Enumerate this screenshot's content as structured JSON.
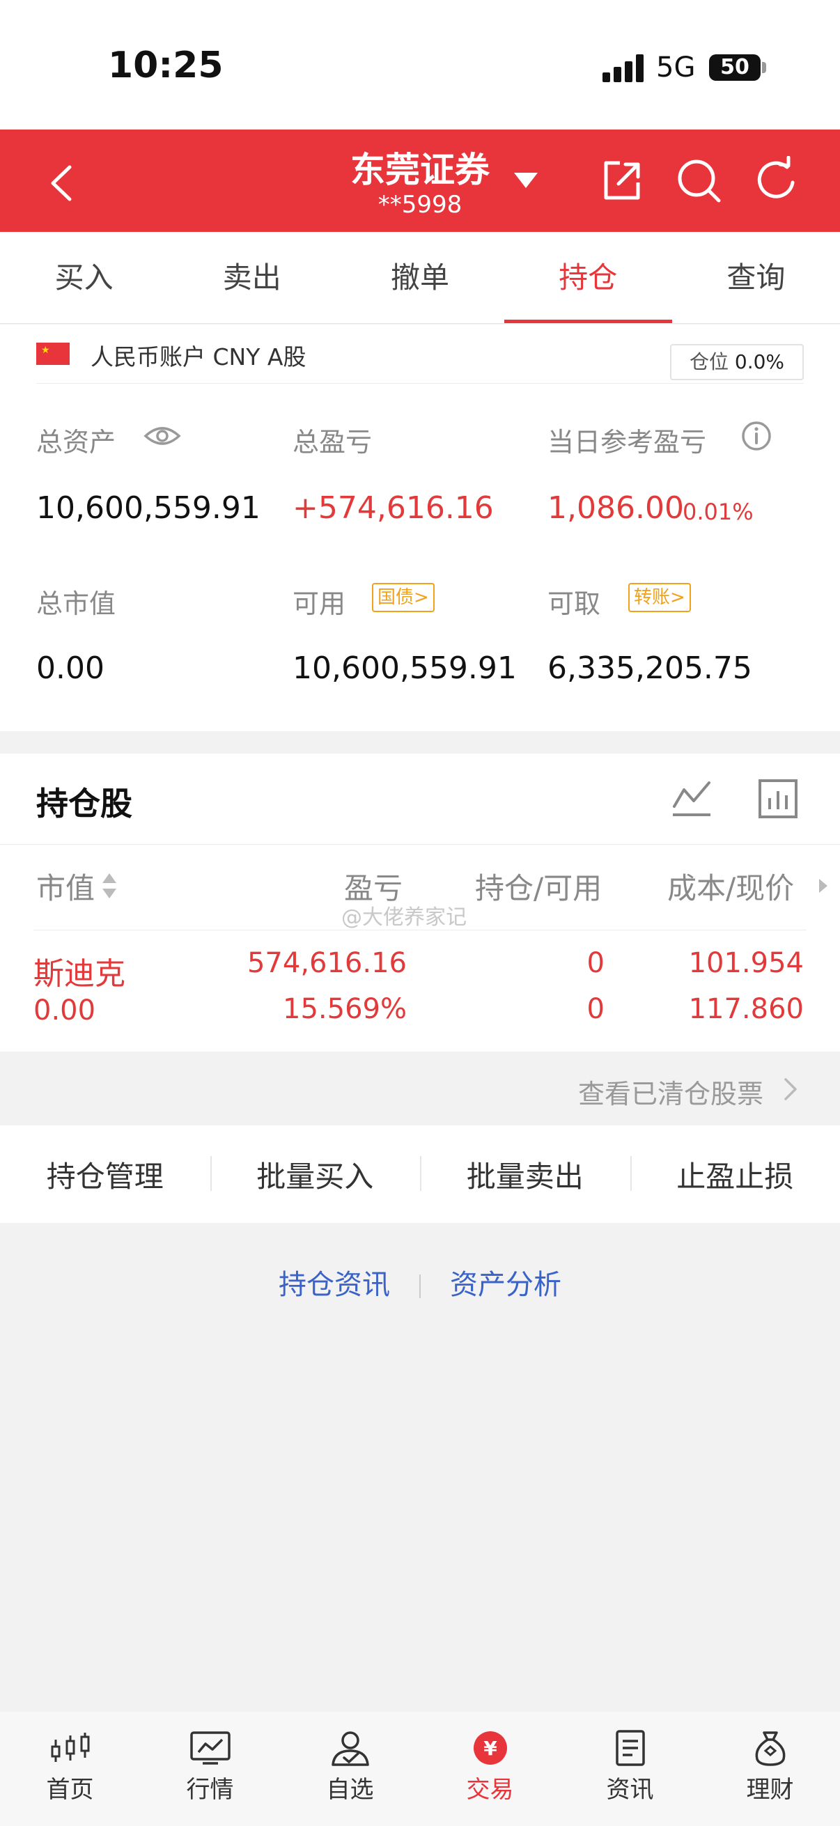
{
  "status_bar": {
    "time": "10:25",
    "network": "5G",
    "battery": "50"
  },
  "header": {
    "broker": "东莞证券",
    "account": "**5998"
  },
  "tabs": [
    {
      "label": "买入",
      "active": false
    },
    {
      "label": "卖出",
      "active": false
    },
    {
      "label": "撤单",
      "active": false
    },
    {
      "label": "持仓",
      "active": true
    },
    {
      "label": "查询",
      "active": false
    }
  ],
  "account": {
    "type": "人民币账户 CNY A股",
    "position_label": "仓位",
    "position_value": "0.0%"
  },
  "summary": {
    "total_assets_label": "总资产",
    "total_assets": "10,600,559.91",
    "total_pl_label": "总盈亏",
    "total_pl": "+574,616.16",
    "daily_pl_label": "当日参考盈亏",
    "daily_pl": "1,086.00",
    "daily_pl_pct": "0.01%",
    "market_value_label": "总市值",
    "market_value": "0.00",
    "available_label": "可用",
    "available_chip": "国债>",
    "available": "10,600,559.91",
    "withdrawable_label": "可取",
    "withdrawable_chip": "转账>",
    "withdrawable": "6,335,205.75"
  },
  "holdings": {
    "title": "持仓股",
    "columns": [
      "市值",
      "盈亏",
      "持仓/可用",
      "成本/现价"
    ],
    "rows": [
      {
        "name": "斯迪克",
        "market_value": "0.00",
        "pl": "574,616.16",
        "pl_pct": "15.569%",
        "position": "0",
        "available": "0",
        "cost": "101.954",
        "price": "117.860"
      }
    ],
    "watermark": "@大佬养家记"
  },
  "cleared_link": "查看已清仓股票",
  "actions": [
    "持仓管理",
    "批量买入",
    "批量卖出",
    "止盈止损"
  ],
  "links": {
    "news": "持仓资讯",
    "analysis": "资产分析"
  },
  "bottom_nav": [
    {
      "label": "首页",
      "icon": "candlestick-icon",
      "active": false
    },
    {
      "label": "行情",
      "icon": "market-chart-icon",
      "active": false
    },
    {
      "label": "自选",
      "icon": "watchlist-user-icon",
      "active": false
    },
    {
      "label": "交易",
      "icon": "trade-yuan-icon",
      "active": true
    },
    {
      "label": "资讯",
      "icon": "news-document-icon",
      "active": false
    },
    {
      "label": "理财",
      "icon": "money-bag-icon",
      "active": false
    }
  ],
  "colors": {
    "brand_red": "#e8353b",
    "profit_red": "#e23a3a",
    "link_blue": "#3a63c9",
    "chip_orange": "#f2a11a"
  }
}
